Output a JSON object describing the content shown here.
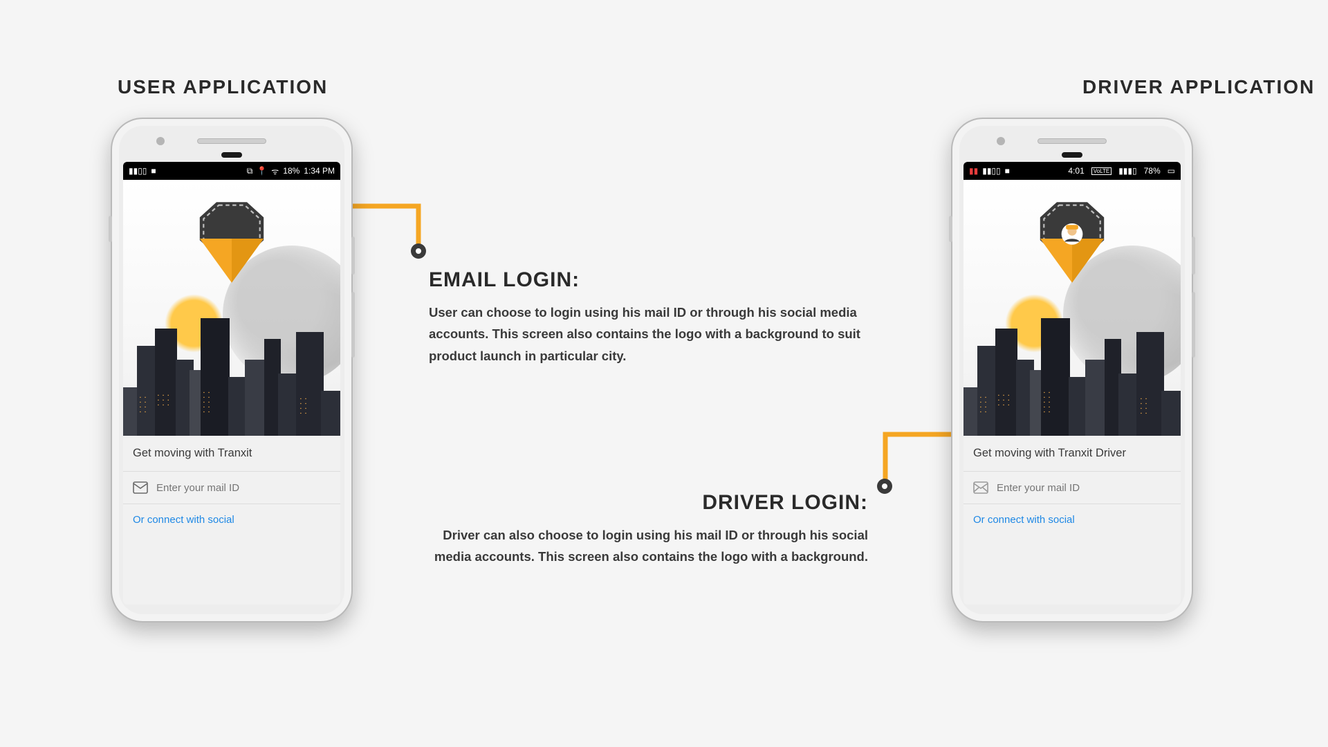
{
  "titles": {
    "left": "USER APPLICATION",
    "right": "DRIVER APPLICATION"
  },
  "userPhone": {
    "status": {
      "time": "1:34 PM",
      "battery": "18%"
    },
    "login": {
      "heading": "Get moving with Tranxit",
      "placeholder": "Enter your mail ID",
      "social": "Or connect with social"
    }
  },
  "driverPhone": {
    "status": {
      "time": "4:01",
      "battery": "78%"
    },
    "login": {
      "heading": "Get moving with Tranxit Driver",
      "placeholder": "Enter your mail ID",
      "social": "Or connect with social"
    }
  },
  "anno": {
    "email": {
      "title": "EMAIL LOGIN:",
      "body": "User can choose to login using his mail ID or through his social media accounts. This screen also contains the logo with a background to suit product launch in particular city."
    },
    "driver": {
      "title": "DRIVER LOGIN:",
      "body": "Driver can also choose to login using his mail ID or through his social media accounts. This screen also contains the logo with a background."
    }
  }
}
